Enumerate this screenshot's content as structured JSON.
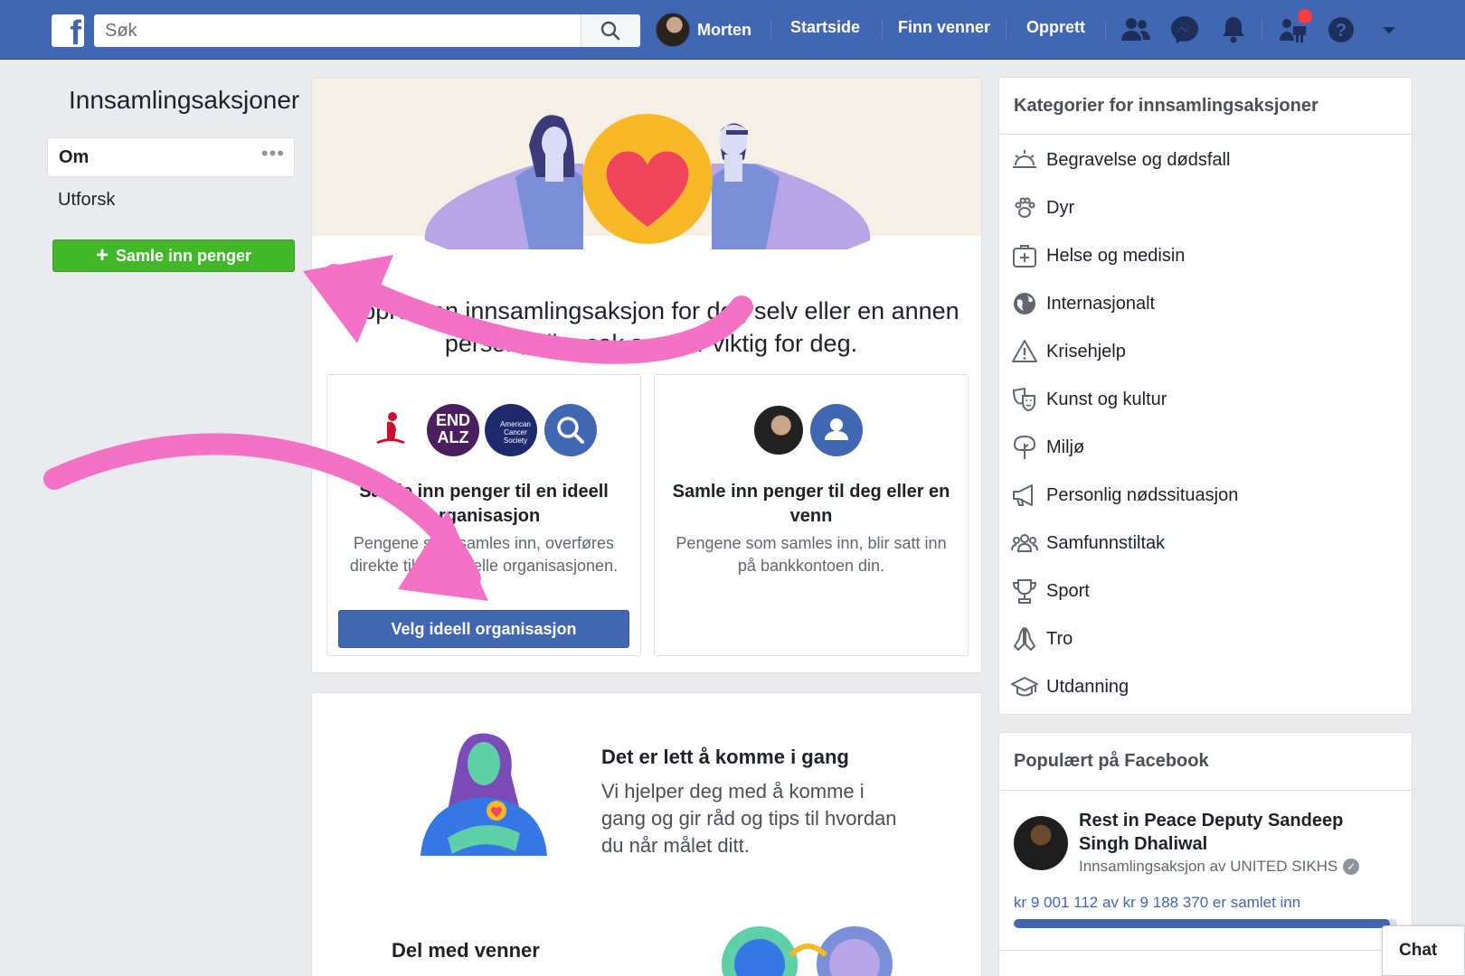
{
  "topbar": {
    "search_placeholder": "Søk",
    "user_name": "Morten",
    "nav": [
      "Startside",
      "Finn venner",
      "Opprett"
    ]
  },
  "left": {
    "title": "Innsamlingsaksjoner",
    "items": [
      "Om",
      "Utforsk"
    ],
    "raise_button": "Samle inn penger"
  },
  "main": {
    "headline_1": "Opprett en innsamlingsaksjon for deg selv eller en annen",
    "headline_2": "person, eller sak som er viktig for deg.",
    "option_org": {
      "title": "Samle inn penger til en ideell organisasjon",
      "desc": "Pengene som samles inn, overføres direkte til den ideelle organisasjonen.",
      "button": "Velg ideell organisasjon",
      "logo_endalz": "END ALZ",
      "logo_acs": "American Cancer Society"
    },
    "option_self": {
      "title": "Samle inn penger til deg eller en venn",
      "desc": "Pengene som samles inn, blir satt inn på bankkontoen din."
    },
    "getting_started": {
      "title": "Det er lett å komme i gang",
      "desc": "Vi hjelper deg med å komme i gang og gir råd og tips til hvordan du når målet ditt."
    },
    "share_title": "Del med venner"
  },
  "categories": {
    "header": "Kategorier for innsamlingsaksjoner",
    "items": [
      {
        "label": "Begravelse og dødsfall",
        "icon": "sunset-icon"
      },
      {
        "label": "Dyr",
        "icon": "paw-icon"
      },
      {
        "label": "Helse og medisin",
        "icon": "medical-kit-icon"
      },
      {
        "label": "Internasjonalt",
        "icon": "globe-icon"
      },
      {
        "label": "Krisehjelp",
        "icon": "warning-icon"
      },
      {
        "label": "Kunst og kultur",
        "icon": "theater-masks-icon"
      },
      {
        "label": "Miljø",
        "icon": "tree-icon"
      },
      {
        "label": "Personlig nødssituasjon",
        "icon": "megaphone-icon"
      },
      {
        "label": "Samfunnstiltak",
        "icon": "people-icon"
      },
      {
        "label": "Sport",
        "icon": "trophy-icon"
      },
      {
        "label": "Tro",
        "icon": "praying-hands-icon"
      },
      {
        "label": "Utdanning",
        "icon": "graduation-cap-icon"
      }
    ]
  },
  "popular": {
    "header": "Populært på Facebook",
    "title": "Rest in Peace Deputy Sandeep Singh Dhaliwal",
    "subtitle": "Innsamlingsaksjon av UNITED SIKHS",
    "amount": "kr 9 001 112 av kr 9 188 370 er samlet inn",
    "progress": 0.98
  },
  "chat_label": "Chat",
  "colors": {
    "brand": "#4267b2",
    "green": "#42b72a",
    "annotation_arrow": "#f472c6"
  }
}
